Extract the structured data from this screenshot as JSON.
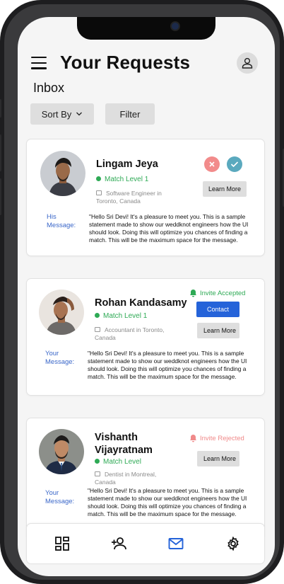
{
  "header": {
    "title": "Your Requests"
  },
  "inbox_label": "Inbox",
  "toolbar": {
    "sort_label": "Sort By",
    "filter_label": "Filter"
  },
  "requests": [
    {
      "name_line1": "Lingam Jeya",
      "name_line2": "",
      "match_label": "Match Level 1",
      "job": "Software Engineer in Toronto, Canada",
      "message_label": "His Message:",
      "message": "\"Hello Sri Devi! It's a pleasure to meet you. This is a sample statement made to show our weddknot engineers how the UI should look. Doing this will optimize you chances  of finding a match. This will be the maximum space for the message.",
      "learn_more": "Learn More"
    },
    {
      "name_line1": "Rohan Kandasamy",
      "name_line2": "",
      "match_label": "Match Level 1",
      "job": "Accountant in Toronto, Canada",
      "message_label": "Your Message:",
      "message": "\"Hello Sri Devi! It's a pleasure to meet you. This is a sample statement made to show our weddknot engineers how the UI should look. Doing this will optimize you chances  of finding a match. This will be the maximum space for the message.",
      "status": "Invite Accepted",
      "contact_label": "Contact",
      "learn_more": "Learn More"
    },
    {
      "name_line1": "Vishanth",
      "name_line2": "Vijayratnam",
      "match_label": "Match Level",
      "job": "Dentist in Montreal, Canada",
      "message_label": "Your Message:",
      "message": "\"Hello Sri Devi! It's a pleasure to meet you. This is a sample statement made to show our weddknot engineers how the UI should look. Doing this will optimize you chances  of finding a match. This will be the maximum space for the message.",
      "status": "Invite Rejected",
      "learn_more": "Learn More"
    }
  ],
  "colors": {
    "accept": "#5aa9be",
    "decline": "#f28b8b",
    "accepted_status": "#2eaa55",
    "rejected_status": "#f08a8a",
    "primary": "#2563d9",
    "match_green": "#2eaa55",
    "message_label": "#3a67c9"
  },
  "bottom_nav": [
    {
      "icon": "dashboard-icon",
      "active": false
    },
    {
      "icon": "add-user-icon",
      "active": false
    },
    {
      "icon": "mail-icon",
      "active": true
    },
    {
      "icon": "settings-icon",
      "active": false
    }
  ]
}
